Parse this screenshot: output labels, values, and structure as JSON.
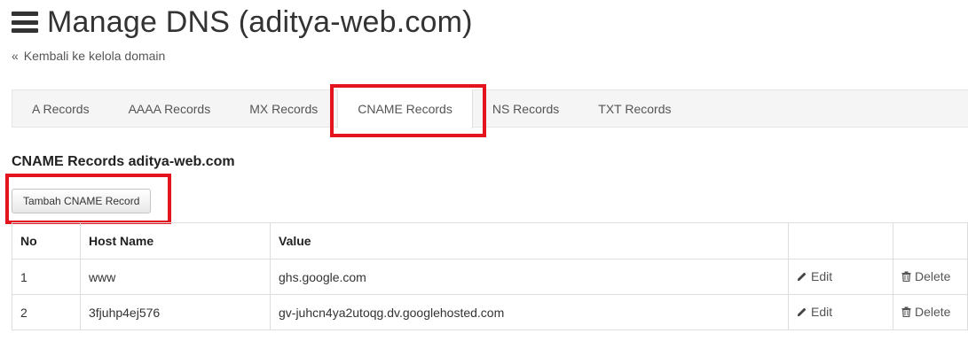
{
  "header": {
    "menu_icon": "hamburger-menu-icon",
    "title": "Manage DNS (aditya-web.com)"
  },
  "back_link": {
    "chevron": "«",
    "label": "Kembali ke kelola domain"
  },
  "tabs": [
    {
      "label": "A Records"
    },
    {
      "label": "AAAA Records"
    },
    {
      "label": "MX Records"
    },
    {
      "label": "CNAME Records",
      "active": true
    },
    {
      "label": "NS Records"
    },
    {
      "label": "TXT Records"
    }
  ],
  "section": {
    "title": "CNAME Records aditya-web.com",
    "add_button": "Tambah CNAME Record"
  },
  "table": {
    "headers": [
      "No",
      "Host Name",
      "Value",
      "",
      ""
    ],
    "rows": [
      {
        "no": "1",
        "host": "www",
        "value": "ghs.google.com",
        "edit": "Edit",
        "delete": "Delete"
      },
      {
        "no": "2",
        "host": "3fjuhp4ej576",
        "value": "gv-juhcn4ya2utoqg.dv.googlehosted.com",
        "edit": "Edit",
        "delete": "Delete"
      }
    ]
  },
  "icons": {
    "edit": "pencil-icon",
    "delete": "trash-icon"
  },
  "colors": {
    "highlight": "#e3141e",
    "tab_bar": "#f5f5f5",
    "text": "#333333"
  }
}
